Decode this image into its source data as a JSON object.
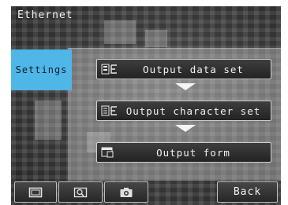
{
  "header": {
    "title": "Ethernet"
  },
  "sidebar": {
    "active_tab": "Settings"
  },
  "menu": {
    "items": [
      {
        "label": "Output data set",
        "icon": "output-data-icon"
      },
      {
        "label": "Output character set",
        "icon": "output-character-icon"
      },
      {
        "label": "Output form",
        "icon": "output-form-icon"
      }
    ]
  },
  "toolbar": {
    "buttons": [
      {
        "icon": "screen-frame-icon"
      },
      {
        "icon": "zoom-icon"
      },
      {
        "icon": "camera-icon"
      }
    ],
    "back_label": "Back"
  },
  "colors": {
    "accent_tab": "#4fb6e8",
    "button_border": "#cfcfcf",
    "background": "#3b3b3b"
  }
}
